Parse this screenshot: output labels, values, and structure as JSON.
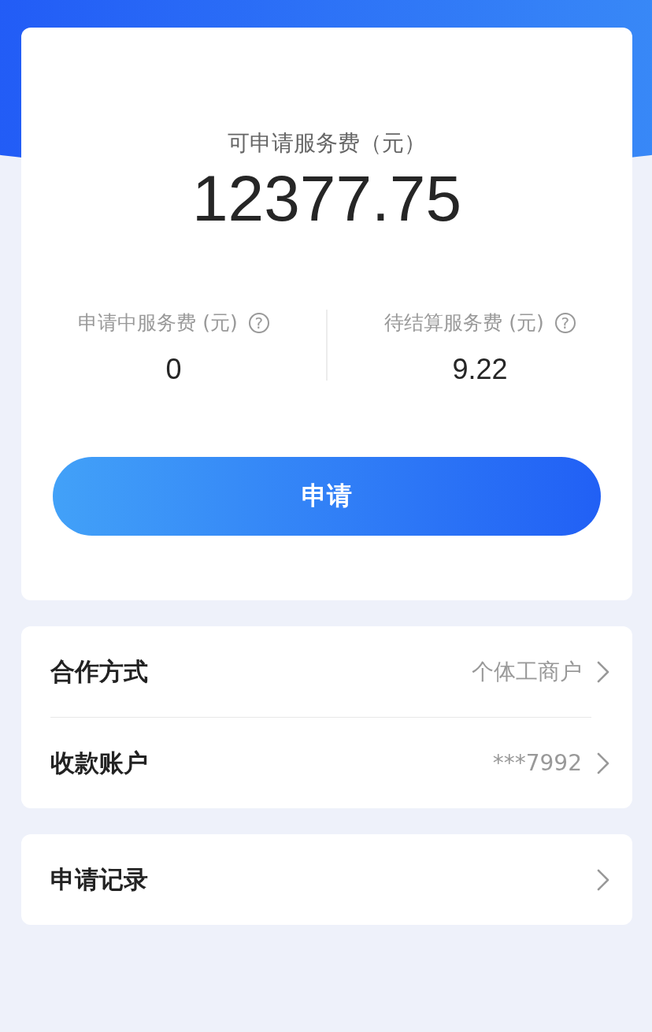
{
  "balance": {
    "label": "可申请服务费（元）",
    "amount": "12377.75"
  },
  "stats": [
    {
      "label": "申请中服务费 (元)",
      "help": "?",
      "value": "0"
    },
    {
      "label": "待结算服务费 (元)",
      "help": "?",
      "value": "9.22"
    }
  ],
  "apply_button": "申请",
  "settings": [
    {
      "label": "合作方式",
      "value": "个体工商户"
    },
    {
      "label": "收款账户",
      "value": "***7992"
    }
  ],
  "records": {
    "label": "申请记录"
  }
}
